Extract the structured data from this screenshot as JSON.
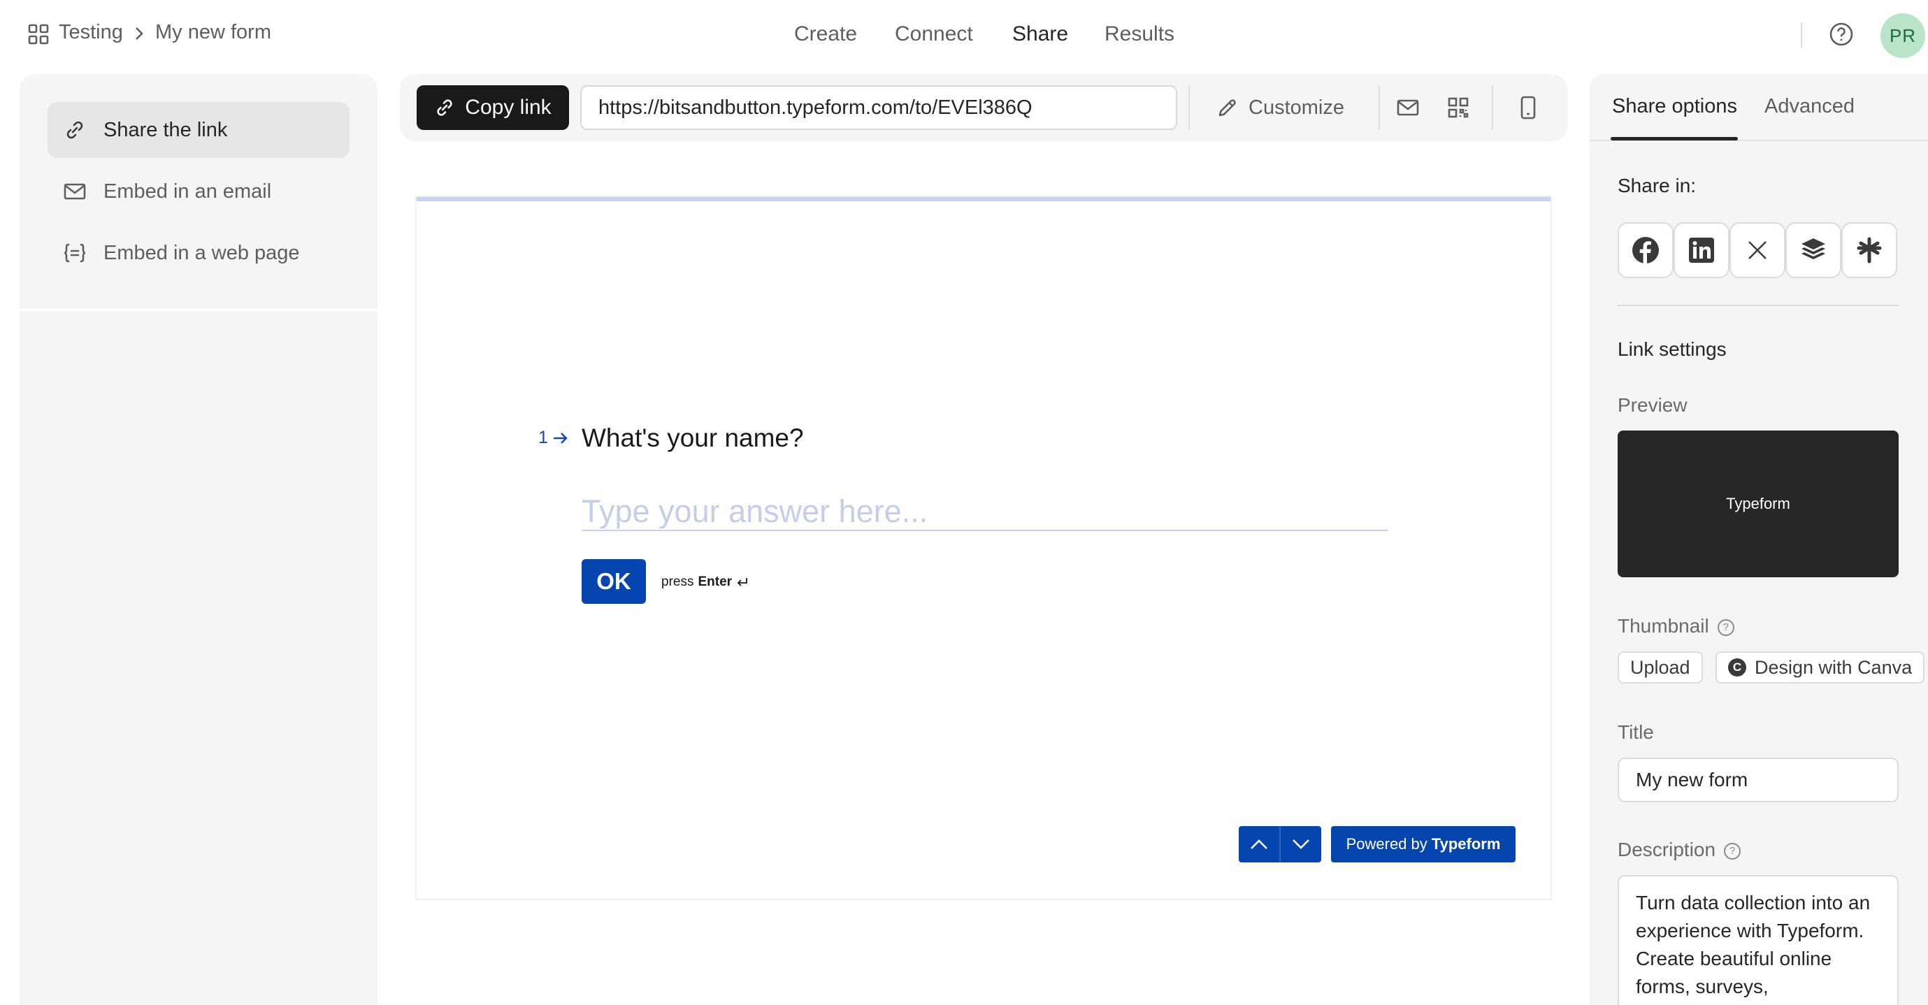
{
  "breadcrumb": {
    "workspace": "Testing",
    "form": "My new form"
  },
  "nav": {
    "create": "Create",
    "connect": "Connect",
    "share": "Share",
    "results": "Results"
  },
  "user": {
    "initials": "PR"
  },
  "left_menu": {
    "items": [
      {
        "label": "Share the link",
        "icon": "link-icon"
      },
      {
        "label": "Embed in an email",
        "icon": "mail-icon"
      },
      {
        "label": "Embed in a web page",
        "icon": "code-brackets-icon"
      }
    ]
  },
  "toolbar": {
    "copy_label": "Copy link",
    "url": "https://bitsandbutton.typeform.com/to/EVEl386Q",
    "customize_label": "Customize"
  },
  "form_preview": {
    "question_number": "1",
    "question": "What's your name?",
    "answer_placeholder": "Type your answer here...",
    "ok_label": "OK",
    "press_prefix": "press",
    "press_key": "Enter",
    "powered_prefix": "Powered by",
    "powered_brand": "Typeform"
  },
  "right_panel": {
    "tabs": [
      "Share options",
      "Advanced"
    ],
    "share_in_label": "Share in:",
    "social_icons": [
      "facebook-icon",
      "linkedin-icon",
      "x-icon",
      "buffer-icon",
      "linktree-icon"
    ],
    "link_settings_label": "Link settings",
    "preview_label": "Preview",
    "preview_card_text": "Typeform",
    "thumbnail_label": "Thumbnail",
    "upload_label": "Upload",
    "canva_label": "Design with Canva",
    "title_label": "Title",
    "title_value": "My new form",
    "description_label": "Description",
    "description_value": "Turn data collection into an experience with Typeform. Create beautiful online forms, surveys,"
  },
  "colors": {
    "accent_blue": "#0445af",
    "dark": "#191919",
    "avatar_bg": "#b9e4c9",
    "panel_bg": "#f5f5f5"
  }
}
